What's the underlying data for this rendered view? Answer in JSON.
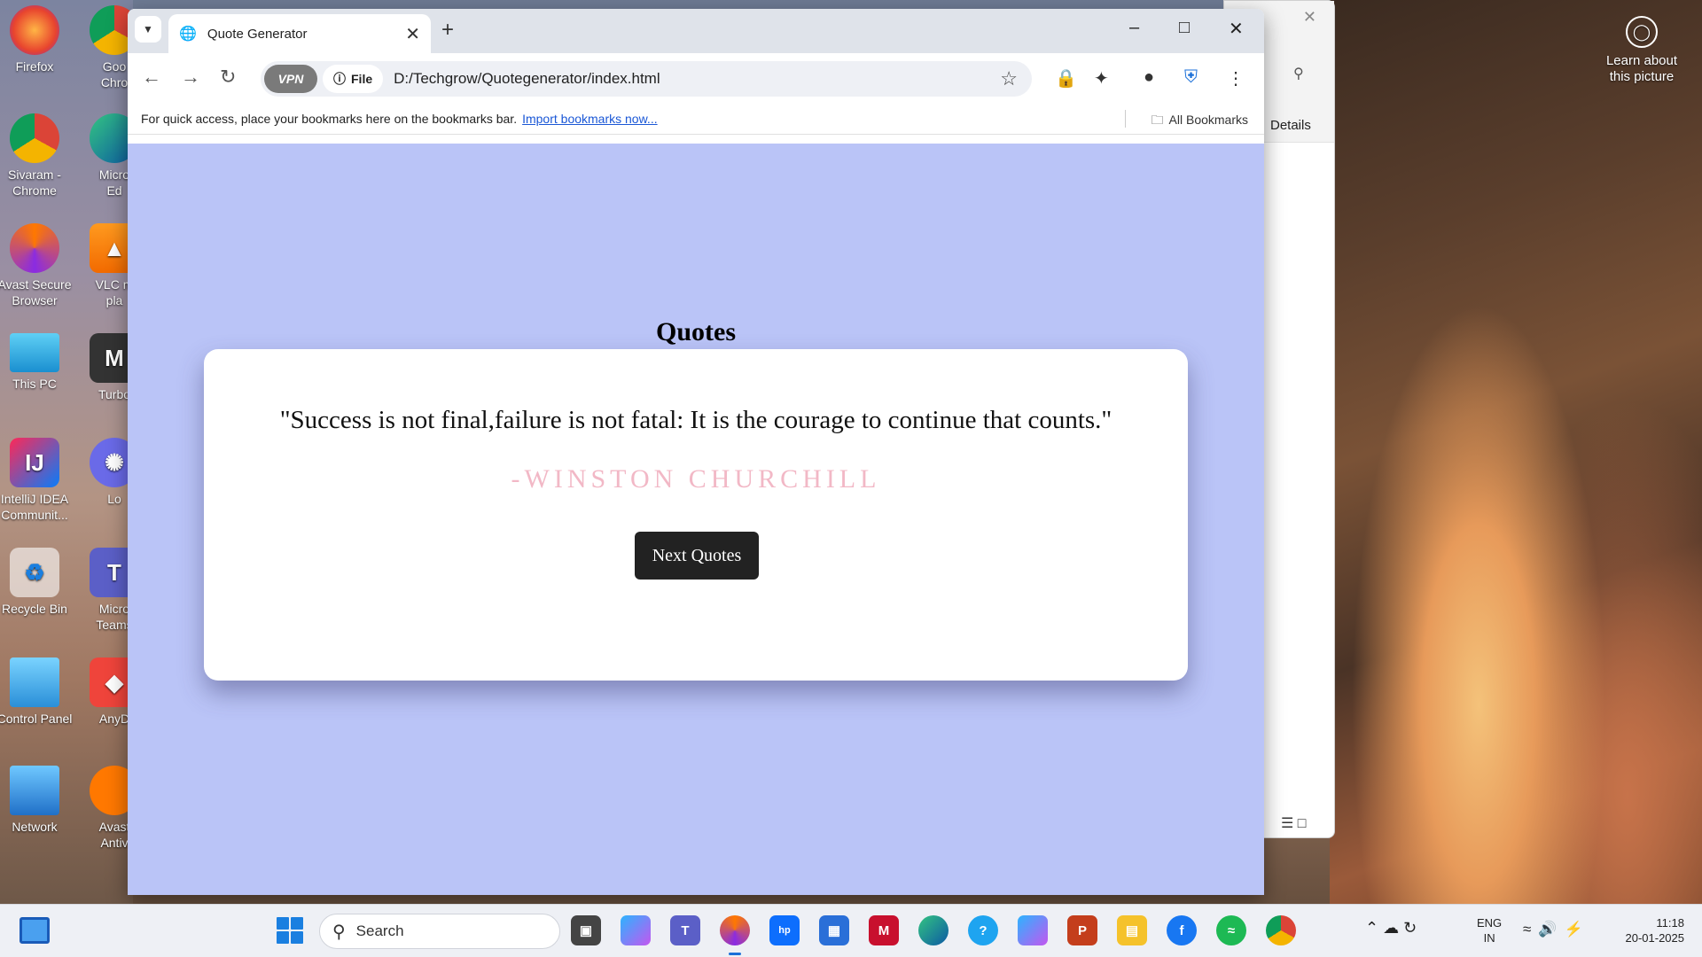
{
  "desktop": {
    "learn_about": "Learn about this picture",
    "icons": [
      {
        "label": "Firefox"
      },
      {
        "label": "Goo\nChro"
      },
      {
        "label": "Sivaram -\nChrome"
      },
      {
        "label": "Micro\nEd"
      },
      {
        "label": "Avast Secure\nBrowser"
      },
      {
        "label": "VLC m\npla"
      },
      {
        "label": "This PC"
      },
      {
        "label": "Turbo"
      },
      {
        "label": "IntelliJ IDEA\nCommunit..."
      },
      {
        "label": "Lo"
      },
      {
        "label": "Recycle Bin"
      },
      {
        "label": "Micro\nTeams"
      },
      {
        "label": "Control Panel"
      },
      {
        "label": "AnyD"
      },
      {
        "label": "Network"
      },
      {
        "label": "Avast\nAntiv"
      }
    ]
  },
  "bg_window": {
    "details_label": "Details"
  },
  "browser": {
    "tab_title": "Quote Generator",
    "omnibox": {
      "vpn_label": "VPN",
      "file_label": "File",
      "url": "D:/Techgrow/Quotegenerator/index.html"
    },
    "bookmarks_bar": {
      "hint": "For quick access, place your bookmarks here on the bookmarks bar.",
      "import_link": "Import bookmarks now...",
      "all_bookmarks": "All Bookmarks"
    }
  },
  "page": {
    "heading": "Quotes",
    "quote": "\"Success is not final,failure is not fatal: It is the courage to continue that counts.\"",
    "author": "-WINSTON CHURCHILL",
    "next_button": "Next Quotes",
    "colors": {
      "background": "#bac4f7",
      "author": "#f2b8c6",
      "button": "#222222"
    }
  },
  "taskbar": {
    "search_placeholder": "Search",
    "lang_line1": "ENG",
    "lang_line2": "IN",
    "time": "11:18",
    "date": "20-01-2025"
  }
}
